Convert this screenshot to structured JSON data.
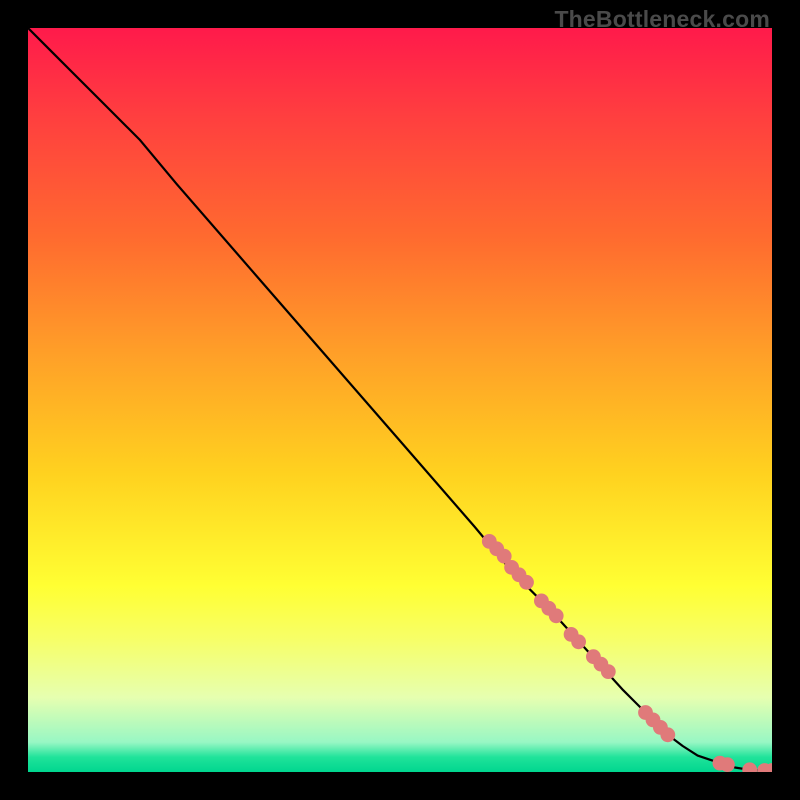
{
  "watermark": "TheBottleneck.com",
  "chart_data": {
    "type": "line",
    "title": "",
    "xlabel": "",
    "ylabel": "",
    "xlim": [
      0,
      100
    ],
    "ylim": [
      0,
      100
    ],
    "legend": false,
    "grid": false,
    "background_gradient": {
      "top": "#ff1a4b",
      "bottom": "#00d68f",
      "stops": [
        "red",
        "orange",
        "yellow",
        "green"
      ]
    },
    "series": [
      {
        "name": "curve",
        "color": "#000000",
        "x": [
          0,
          3,
          6,
          10,
          15,
          20,
          30,
          40,
          50,
          60,
          65,
          70,
          75,
          80,
          83,
          86,
          88,
          90,
          93,
          95,
          97,
          98.5,
          100
        ],
        "y": [
          100,
          97,
          94,
          90,
          85,
          79,
          67.5,
          56,
          44.5,
          33,
          27,
          22,
          16.5,
          11,
          8,
          5,
          3.5,
          2.2,
          1.2,
          0.6,
          0.3,
          0.2,
          0.2
        ]
      }
    ],
    "markers": {
      "name": "highlighted-points",
      "color": "#e07a7a",
      "radius_pct": 1.0,
      "x": [
        62,
        63,
        64,
        65,
        66,
        67,
        69,
        70,
        71,
        73,
        74,
        76,
        77,
        78,
        83,
        84,
        85,
        86,
        93,
        94,
        97,
        99,
        100
      ],
      "y": [
        31,
        30,
        29,
        27.5,
        26.5,
        25.5,
        23,
        22,
        21,
        18.5,
        17.5,
        15.5,
        14.5,
        13.5,
        8,
        7,
        6,
        5,
        1.2,
        1.0,
        0.3,
        0.2,
        0.2
      ]
    }
  }
}
